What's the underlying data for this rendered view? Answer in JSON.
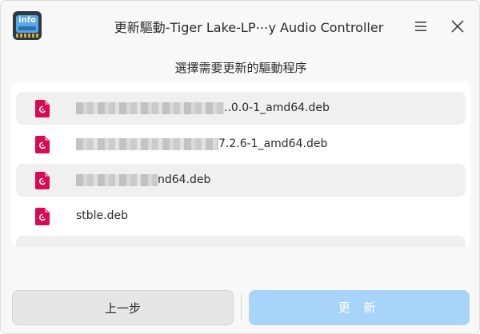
{
  "window": {
    "title": "更新驅動-Tiger Lake-LP⋯y Audio Controller",
    "app_icon_text": "info"
  },
  "prompt": "選擇需要更新的驅動程序",
  "files": [
    {
      "visible_text": "..0.0-1_amd64.deb"
    },
    {
      "visible_text": "7.2.6-1_amd64.deb"
    },
    {
      "visible_text": "nd64.deb"
    },
    {
      "visible_text": "stble.deb"
    }
  ],
  "buttons": {
    "back": "上一步",
    "update": "更 新"
  },
  "colors": {
    "accent": "#a9d4f9",
    "deb_icon": "#d70a53",
    "row_alt": "#f0f0f0"
  },
  "icons": {
    "app": "hardware-info-icon",
    "menu": "hamburger-menu-icon",
    "close": "close-icon",
    "file": "debian-package-icon"
  }
}
